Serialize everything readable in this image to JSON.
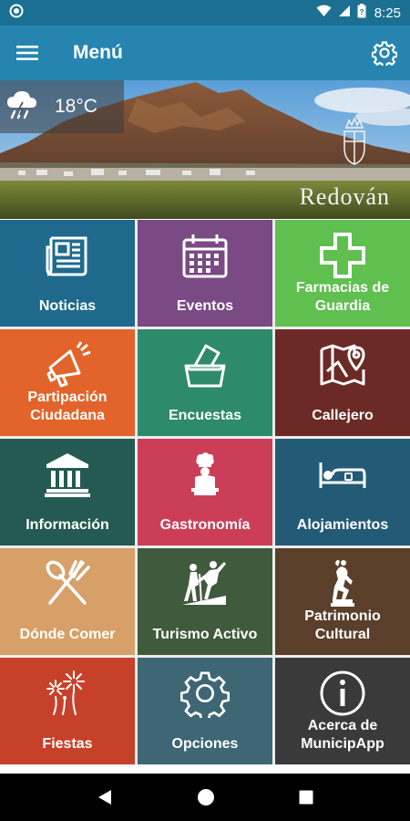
{
  "status_bar": {
    "time": "8:25",
    "icons": [
      "app-notification-icon",
      "wifi-icon",
      "signal-icon",
      "battery-icon"
    ]
  },
  "app_bar": {
    "title": "Menú",
    "menu_icon": "hamburger-menu-icon",
    "settings_icon": "gear-icon"
  },
  "banner": {
    "weather_icon": "rain-cloud-icon",
    "temperature": "18°C",
    "town_name": "Redován"
  },
  "tiles": [
    {
      "label": "Noticias",
      "color": "#1f6a8c",
      "icon": "newspaper-icon"
    },
    {
      "label": "Eventos",
      "color": "#7a4a85",
      "icon": "calendar-icon"
    },
    {
      "label": "Farmacias de Guardia",
      "color": "#5fbf4f",
      "icon": "pharmacy-cross-icon"
    },
    {
      "label": "Partipación Ciudadana",
      "color": "#e2642a",
      "icon": "megaphone-icon"
    },
    {
      "label": "Encuestas",
      "color": "#2d8a6a",
      "icon": "ballot-box-icon"
    },
    {
      "label": "Callejero",
      "color": "#6b2a26",
      "icon": "map-pin-icon"
    },
    {
      "label": "Información",
      "color": "#245a52",
      "icon": "institution-building-icon"
    },
    {
      "label": "Gastronomía",
      "color": "#cc3e58",
      "icon": "chef-icon"
    },
    {
      "label": "Alojamientos",
      "color": "#235b77",
      "icon": "bed-icon"
    },
    {
      "label": "Dónde Comer",
      "color": "#d7a068",
      "icon": "fork-spoon-icon"
    },
    {
      "label": "Turismo Activo",
      "color": "#3f5a3c",
      "icon": "hiking-icon"
    },
    {
      "label": "Patrimonio Cultural",
      "color": "#5a3f2b",
      "icon": "statue-icon"
    },
    {
      "label": "Fiestas",
      "color": "#c7412a",
      "icon": "fireworks-icon"
    },
    {
      "label": "Opciones",
      "color": "#3e6675",
      "icon": "gear-icon"
    },
    {
      "label": "Acerca de MunicipApp",
      "color": "#3a3a3a",
      "icon": "info-icon"
    }
  ],
  "nav_bar": {
    "icons": [
      "back-icon",
      "home-icon",
      "recents-icon"
    ]
  }
}
